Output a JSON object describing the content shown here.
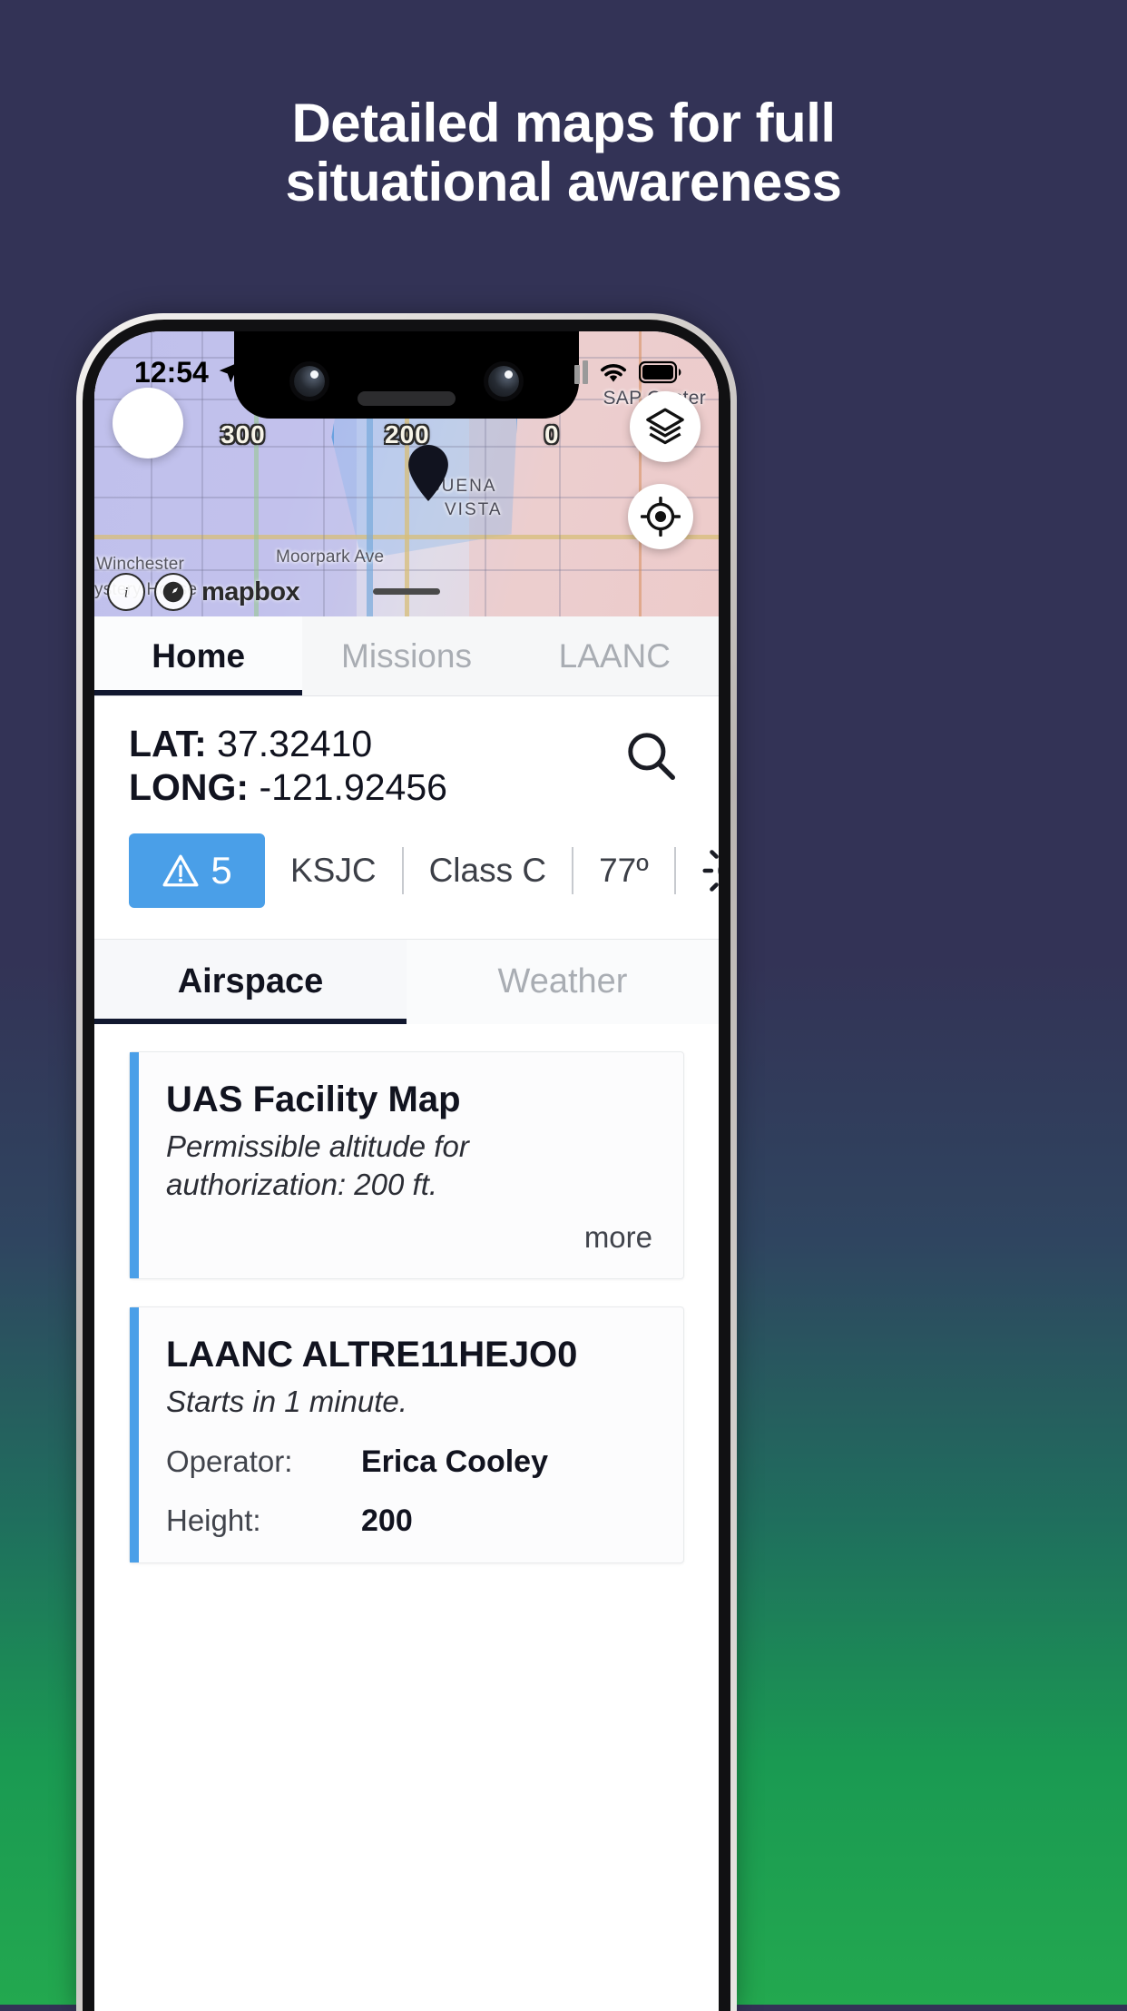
{
  "promo": {
    "heading_line1": "Detailed maps for full",
    "heading_line2": "situational awareness",
    "bg_color": "#333356",
    "accent_green": "#23a84f",
    "accent_teal": "#37d39b"
  },
  "statusbar": {
    "time": "12:54",
    "location_arrow_icon": "location-arrow-icon",
    "signal_icon": "cellular-signal-icon",
    "wifi_icon": "wifi-icon",
    "battery_icon": "battery-full-icon"
  },
  "map": {
    "menu_icon": "hamburger-menu-icon",
    "layers_icon": "map-layers-icon",
    "locate_icon": "locate-me-icon",
    "pin_icon": "map-pin-icon",
    "attribution_info_icon": "info-icon",
    "attribution_logo_icon": "mapbox-logo-icon",
    "attribution_word": "mapbox",
    "grabber_icon": "sheet-grabber",
    "altitude_labels": [
      "300",
      "200",
      "0"
    ],
    "place_labels": {
      "sap_center": "SAP Center",
      "buena": "BUENA",
      "vista": "VISTA",
      "moorpark": "Moorpark Ave",
      "winchester": "Winchester",
      "mystery_house": "ystery House"
    }
  },
  "main_tabs": [
    {
      "label": "Home",
      "active": true
    },
    {
      "label": "Missions",
      "active": false
    },
    {
      "label": "LAANC",
      "active": false
    }
  ],
  "coordinates": {
    "lat_label": "LAT:",
    "lat_value": "37.32410",
    "long_label": "LONG:",
    "long_value": "-121.92456",
    "search_icon": "search-icon"
  },
  "chips": {
    "warning_icon": "warning-triangle-icon",
    "warning_count": "5",
    "warning_color": "#4a9fe8",
    "airport": "KSJC",
    "airspace_class": "Class C",
    "temperature": "77º",
    "weather_icon": "sun-icon"
  },
  "sub_tabs": [
    {
      "label": "Airspace",
      "active": true
    },
    {
      "label": "Weather",
      "active": false
    }
  ],
  "cards": [
    {
      "title": "UAS Facility Map",
      "subtitle": "Permissible altitude for authorization: 200 ft.",
      "more_label": "more"
    },
    {
      "title": "LAANC ALTRE11HEJO0",
      "subtitle": "Starts in 1 minute.",
      "operator_key": "Operator:",
      "operator_value": "Erica Cooley",
      "height_key": "Height:",
      "height_value": "200"
    }
  ]
}
